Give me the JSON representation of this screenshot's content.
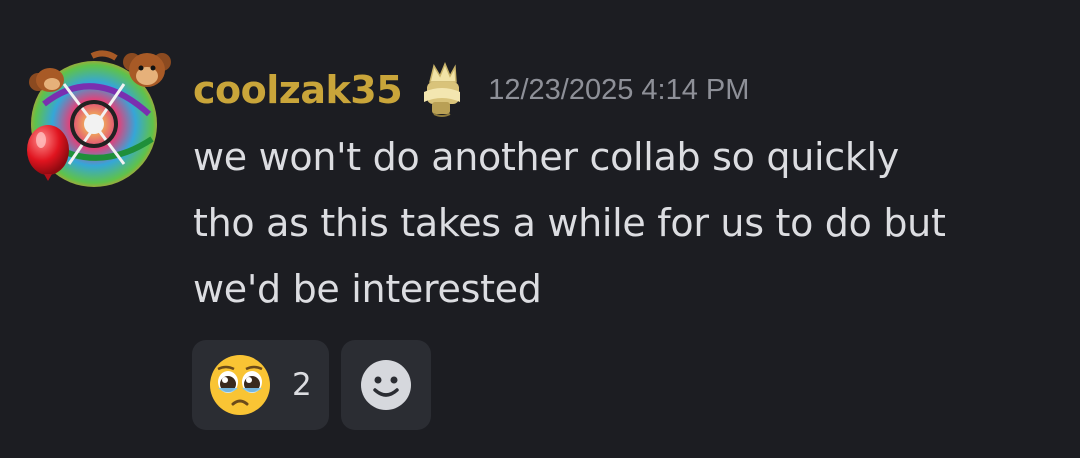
{
  "message": {
    "author": {
      "username": "coolzak35",
      "name_color": "#c9a53a",
      "avatar_icon": "monkey-balloon-avatar-icon",
      "role_icon": "golden-crown-scroll-icon"
    },
    "timestamp": "12/23/2025 4:14 PM",
    "lines": [
      "we won't do another collab so quickly",
      "tho as this takes a while for us to do but",
      "we'd be interested"
    ],
    "reactions": [
      {
        "emoji_icon": "pleading-face-emoji-icon",
        "count": "2"
      }
    ],
    "add_reaction_icon": "add-reaction-smiley-icon"
  },
  "colors": {
    "background": "#1c1d22",
    "text": "#dcdde1",
    "timestamp": "#8e9098",
    "reaction_bg": "#2b2d33"
  }
}
